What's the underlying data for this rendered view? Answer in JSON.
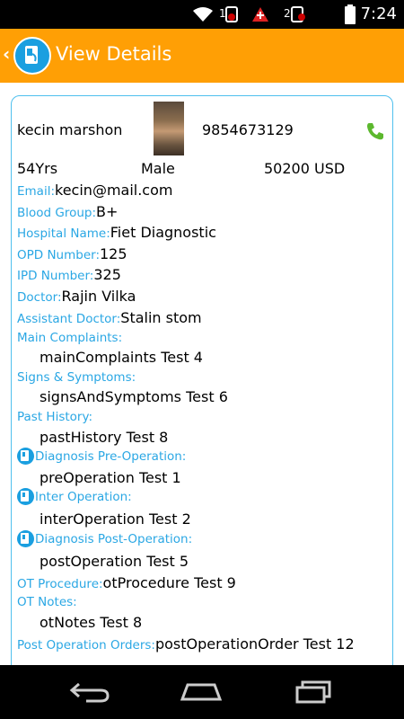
{
  "status_bar": {
    "time": "7:24",
    "sim1": "1",
    "sim2": "2"
  },
  "header": {
    "title": "View Details",
    "back_glyph": "‹"
  },
  "patient": {
    "name": "kecin marshon",
    "phone": "9854673129",
    "age": "54Yrs",
    "gender": "Male",
    "amount": "50200 USD"
  },
  "fields": {
    "email": {
      "label": "Email:",
      "value": "kecin@mail.com"
    },
    "blood_group": {
      "label": "Blood Group:",
      "value": "B+"
    },
    "hospital": {
      "label": "Hospital Name:",
      "value": "Fiet Diagnostic"
    },
    "opd": {
      "label": "OPD Number:",
      "value": "125"
    },
    "ipd": {
      "label": "IPD Number:",
      "value": "325"
    },
    "doctor": {
      "label": "Doctor:",
      "value": "Rajin Vilka"
    },
    "assistant": {
      "label": "Assistant Doctor:",
      "value": "Stalin stom"
    },
    "main_complaints": {
      "label": "Main Complaints:",
      "value": "mainComplaints Test 4"
    },
    "signs": {
      "label": "Signs & Symptoms:",
      "value": "signsAndSymptoms Test 6"
    },
    "past_history": {
      "label": "Past History:",
      "value": "pastHistory Test 8"
    },
    "diag_pre": {
      "label": "Diagnosis Pre-Operation:",
      "value": "preOperation Test 1"
    },
    "inter_op": {
      "label": "Inter Operation:",
      "value": "interOperation Test 2"
    },
    "diag_post": {
      "label": "Diagnosis Post-Operation:",
      "value": "postOperation Test 5"
    },
    "ot_procedure": {
      "label": "OT Procedure:",
      "value": "otProcedure Test 9"
    },
    "ot_notes": {
      "label": "OT Notes:",
      "value": "otNotes Test 8"
    },
    "post_orders": {
      "label": "Post Operation Orders:",
      "value": "postOperationOrder Test 12"
    }
  },
  "colors": {
    "accent": "#ff9f05",
    "label": "#2aa7e4",
    "border": "#4fc0ee",
    "icon_blue": "#1a9fe0",
    "call_green": "#5cb82e"
  },
  "icons": [
    "wifi-icon",
    "sim-icon",
    "alert-icon",
    "battery-icon",
    "app-logo-icon",
    "phone-call-icon",
    "document-icon",
    "back-nav-icon",
    "home-nav-icon",
    "recents-nav-icon"
  ]
}
